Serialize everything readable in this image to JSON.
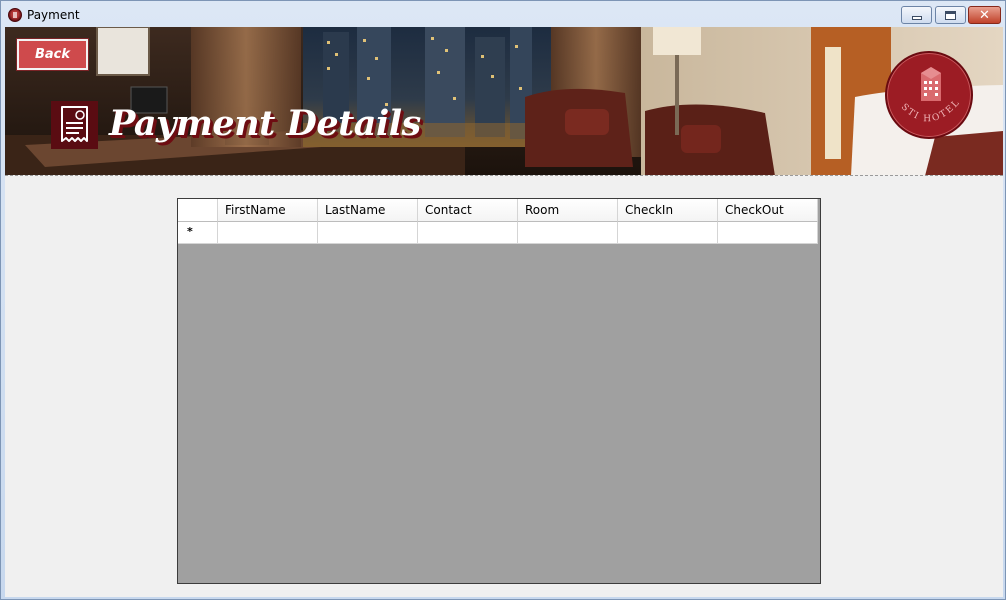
{
  "window": {
    "title": "Payment",
    "close_glyph": "✕"
  },
  "banner": {
    "back_label": "Back",
    "page_title": "Payment Details",
    "logo_text": "STI HOTEL",
    "accent_color": "#cf4a4c",
    "icon": "receipt-icon"
  },
  "grid": {
    "columns": [
      "FirstName",
      "LastName",
      "Contact",
      "Room",
      "CheckIn",
      "CheckOut"
    ],
    "new_row_marker": "*",
    "rows": [
      {
        "values": [
          "",
          "",
          "",
          "",
          "",
          ""
        ]
      }
    ]
  }
}
